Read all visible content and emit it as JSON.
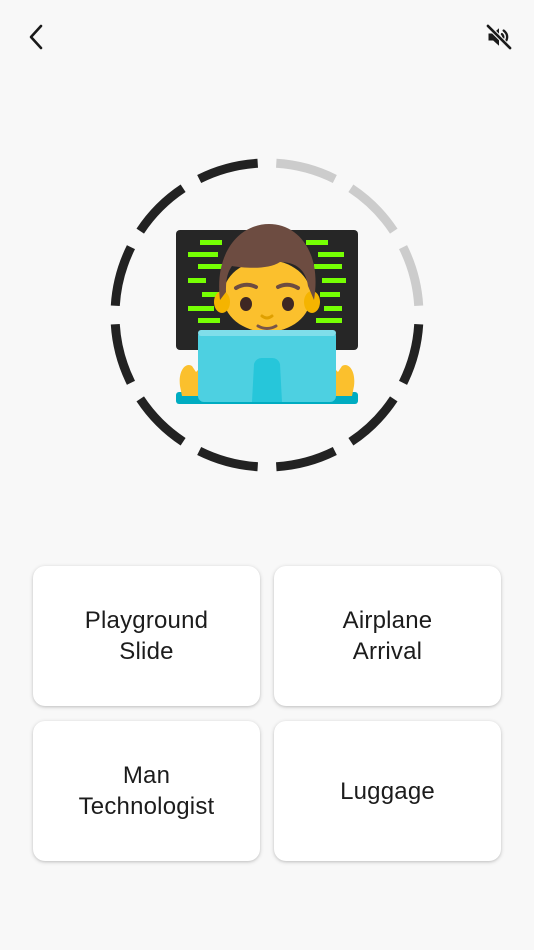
{
  "header": {
    "back_icon": "chevron-left-icon",
    "mute_icon": "speaker-muted-icon"
  },
  "timer": {
    "total_segments": 12,
    "remaining_segments": 9,
    "active_color": "#222222",
    "inactive_color": "#cccccc"
  },
  "question": {
    "emoji_name": "man-technologist",
    "emoji_char": "👨‍💻"
  },
  "answers": [
    {
      "label": "Playground\nSlide"
    },
    {
      "label": "Airplane\nArrival"
    },
    {
      "label": "Man\nTechnologist"
    },
    {
      "label": "Luggage"
    }
  ]
}
